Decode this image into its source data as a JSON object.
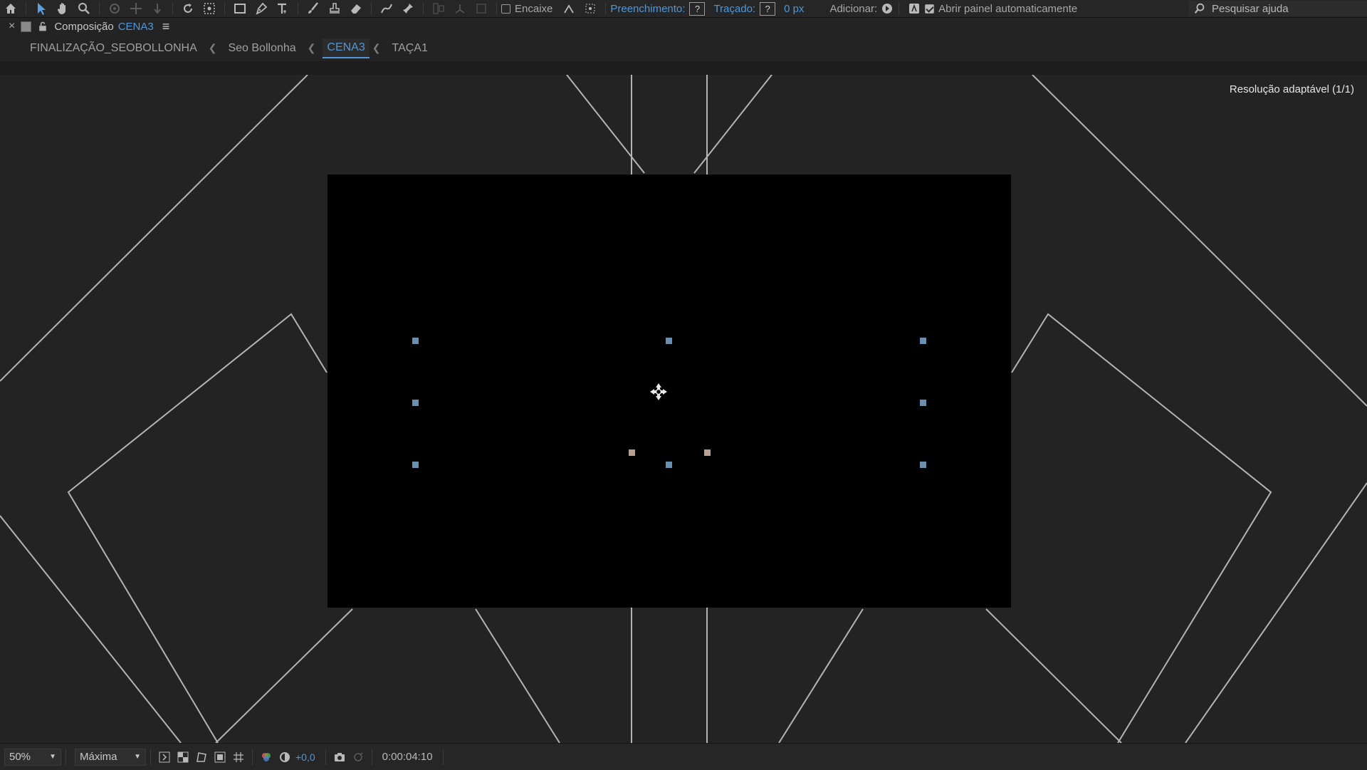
{
  "toolbar": {
    "tools": [
      "home-icon",
      "selection-arrow-icon",
      "hand-icon",
      "zoom-icon",
      "orbit-camera-icon",
      "pan-camera-icon",
      "dolly-camera-icon",
      "rotate-icon",
      "pan-behind-icon",
      "rectangle-icon",
      "pen-icon",
      "type-icon",
      "brush-icon",
      "clone-stamp-icon",
      "eraser-icon",
      "roto-brush-icon",
      "puppet-pin-icon"
    ],
    "snapping_label": "Encaixe",
    "fill_label": "Preenchimento:",
    "fill_value": "?",
    "stroke_label": "Traçado:",
    "stroke_value": "?",
    "stroke_width": "0 px",
    "add_label": "Adicionar:",
    "auto_open_label": "Abrir painel automaticamente",
    "search_placeholder": "Pesquisar ajuda"
  },
  "panel": {
    "close": "×",
    "title": "Composição",
    "comp_name": "CENA3",
    "menu": "≡"
  },
  "breadcrumbs": {
    "items": [
      "FINALIZAÇÃO_SEOBOLLONHA",
      "Seo Bollonha",
      "CENA3",
      "TAÇA1"
    ],
    "current_index": 2
  },
  "viewer": {
    "resolution_label": "Resolução adaptável (1/1)"
  },
  "bottom_bar": {
    "zoom": "50%",
    "quality": "Máxima",
    "exposure": "+0,0",
    "timecode": "0:00:04:10"
  },
  "colors": {
    "accent": "#4f97d9",
    "handle": "#6b8fae",
    "tangent": "#b89f90",
    "panel_bg": "#232323",
    "comp_bg": "#000000"
  }
}
